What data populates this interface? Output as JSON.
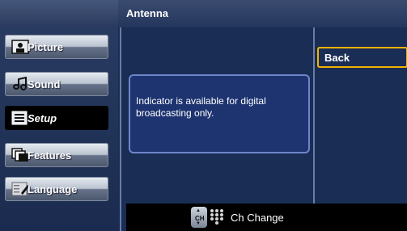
{
  "menu": {
    "items": [
      {
        "label": "Picture",
        "icon": "picture-icon",
        "active": false
      },
      {
        "label": "Sound",
        "icon": "sound-icon",
        "active": false
      },
      {
        "label": "Setup",
        "icon": "setup-icon",
        "active": true
      },
      {
        "label": "Features",
        "icon": "features-icon",
        "active": false
      },
      {
        "label": "Language",
        "icon": "language-icon",
        "active": false
      }
    ]
  },
  "header": {
    "title": "Antenna"
  },
  "info": {
    "text": "Indicator is available for digital broadcasting only."
  },
  "buttons": {
    "back_label": "Back"
  },
  "footer": {
    "remote_label": "CH",
    "hint": "Ch Change"
  },
  "colors": {
    "accent": "#F3B400",
    "panel": "#1A2D55",
    "info_border": "#6E86C8"
  }
}
